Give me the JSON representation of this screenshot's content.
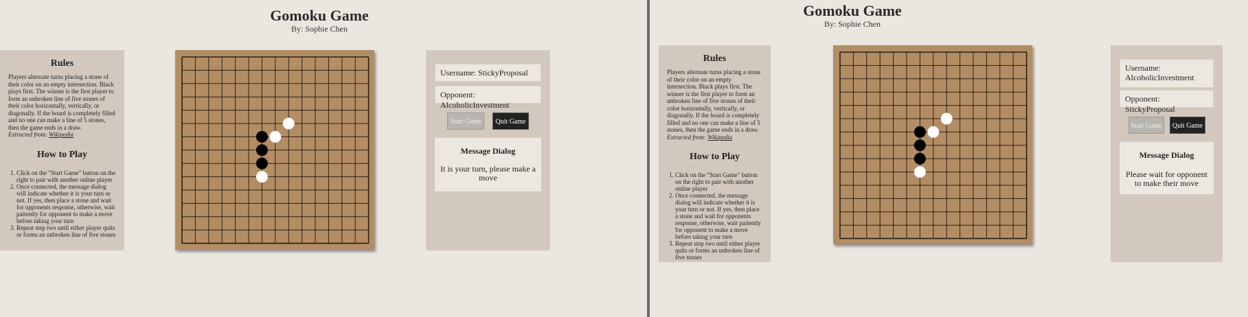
{
  "windows": [
    {
      "app": {
        "title": "Gomoku Game",
        "byline": "By: Sophie Chen"
      },
      "rules": {
        "heading": "Rules",
        "text": "Players alternate turns placing a stone of their color on an empty intersection. Black plays first. The winner is the first player to form an unbroken line of five stones of their color horizontally, vertically, or diagonally. If the board is completely filled and no one can make a line of 5 stones, then the game ends in a draw.",
        "source_label": "Extracted from:",
        "source_link": "Wikipedia"
      },
      "howto": {
        "heading": "How to Play",
        "steps": [
          "Click on the \"Start Game\" button on the right to pair with another online player",
          "Once connected, the message dialog will indicate whether it is your turn or not. If yes, then place a stone and wait for opponents response, otherwise, wait paitently for opponent to make a move before taking your turn",
          "Repeat step two until either player quits or forms an unbroken line of five stones"
        ]
      },
      "player": {
        "username": "Username: StickyProposal",
        "opponent": "Opponent: AlcoholicInvestment"
      },
      "buttons": {
        "start": "Start Game",
        "quit": "Quit Game"
      },
      "dialog": {
        "heading": "Message Dialog",
        "message": "It is your turn, please make a move"
      }
    },
    {
      "app": {
        "title": "Gomoku Game",
        "byline": "By: Sophie Chen"
      },
      "rules": {
        "heading": "Rules",
        "text": "Players alternate turns placing a stone of their color on an empty intersection. Black plays first. The winner is the first player to form an unbroken line of five stones of their color horizontally, vertically, or diagonally. If the board is completely filled and no one can make a line of 5 stones, then the game ends in a draw.",
        "source_label": "Extracted from:",
        "source_link": "Wikipedia"
      },
      "howto": {
        "heading": "How to Play",
        "steps": [
          "Click on the \"Start Game\" button on the right to pair with another online player",
          "Once connected, the message dialog will indicate whether it is your turn or not. If yes, then place a stone and wait for opponents response, otherwise, wait paitently for opponent to make a move before taking your turn",
          "Repeat step two until either player quits or forms an unbroken line of five stones"
        ]
      },
      "player": {
        "username": "Username: AlcoholicInvestment",
        "opponent": "Opponent: StickyProposal"
      },
      "buttons": {
        "start": "Start Game",
        "quit": "Quit Game"
      },
      "dialog": {
        "heading": "Message Dialog",
        "message": "Please wait for opponent to make their move"
      }
    }
  ],
  "board": {
    "size": 15,
    "stones": [
      {
        "col": 6,
        "row": 6,
        "color": "black"
      },
      {
        "col": 6,
        "row": 7,
        "color": "black"
      },
      {
        "col": 6,
        "row": 8,
        "color": "black"
      },
      {
        "col": 6,
        "row": 9,
        "color": "white"
      },
      {
        "col": 7,
        "row": 6,
        "color": "white"
      },
      {
        "col": 8,
        "row": 5,
        "color": "white"
      }
    ]
  },
  "colors": {
    "board": "#b38d63",
    "grid": "#2a2218",
    "panel": "#d2c8bd",
    "black_stone": "#000000",
    "white_stone": "#ffffff"
  }
}
